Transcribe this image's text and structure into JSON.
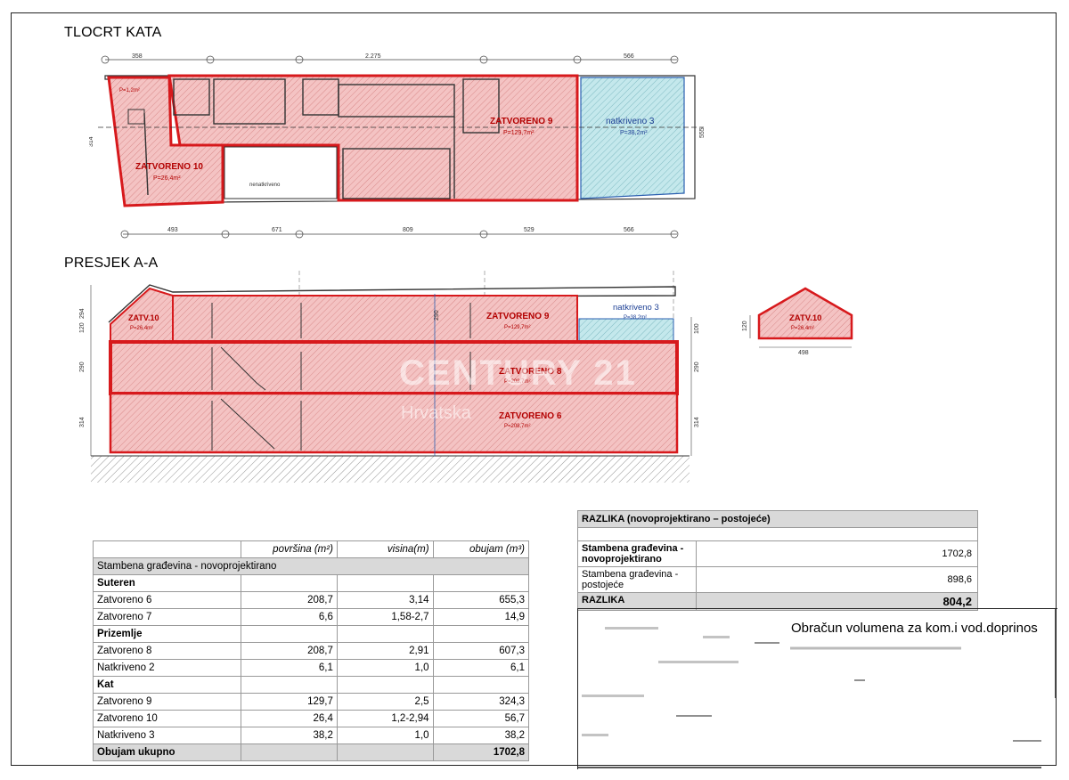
{
  "floor_plan": {
    "title": "TLOCRT KATA",
    "dims_top": [
      "358",
      "2.275",
      "566"
    ],
    "dims_bottom": [
      "493",
      "671",
      "809",
      "529",
      "566"
    ],
    "dim_left": "314",
    "dim_right": "555",
    "grid_labels_top": [
      "①",
      "②",
      "③",
      "④",
      "⑤",
      "⑥"
    ],
    "zones": {
      "zatvoreno10": {
        "label": "ZATVORENO 10",
        "area": "P=26,4m²"
      },
      "zatvoreno9": {
        "label": "ZATVORENO 9",
        "area": "P=129,7m²"
      },
      "natkriveno3": {
        "label": "natkriveno 3",
        "area": "P=38,2m²"
      },
      "nenatkriveno": "nenatkriveno",
      "small_area": "P=1,2m²"
    }
  },
  "section": {
    "title": "PRESJEK A-A",
    "zones": {
      "zatv10": {
        "label": "ZATV.10",
        "area": "P=26,4m²"
      },
      "zatvoreno9": {
        "label": "ZATVORENO 9",
        "area": "P=129,7m²"
      },
      "natkriveno3": {
        "label": "natkriveno 3",
        "area": "P=38,2m²"
      },
      "zatvoreno8": {
        "label": "ZATVORENO 8",
        "area": "P=208,7m²"
      },
      "zatvoreno6": {
        "label": "ZATVORENO 6",
        "area": "P=208,7m²"
      }
    },
    "dims_left": [
      "294",
      "120",
      "290",
      "314"
    ],
    "dims_right": [
      "100",
      "290",
      "314"
    ],
    "dim_middle": "290"
  },
  "roof_detail": {
    "label": "ZATV.10",
    "area": "P=26,4m²",
    "width": "498",
    "height": "120"
  },
  "watermark": {
    "brand": "CENTURY 21",
    "sub": "Hrvatska"
  },
  "volume_table": {
    "headers": [
      "",
      "površina (m²)",
      "visina(m)",
      "obujam (m³)"
    ],
    "building": "Stambena građevina - novoprojektirano",
    "groups": [
      {
        "name": "Suteren",
        "rows": [
          {
            "name": "Zatvoreno 6",
            "area": "208,7",
            "height": "3,14",
            "volume": "655,3"
          },
          {
            "name": "Zatvoreno 7",
            "area": "6,6",
            "height": "1,58-2,7",
            "volume": "14,9"
          }
        ]
      },
      {
        "name": "Prizemlje",
        "rows": [
          {
            "name": "Zatvoreno  8",
            "area": "208,7",
            "height": "2,91",
            "volume": "607,3"
          },
          {
            "name": "Natkriveno 2",
            "area": "6,1",
            "height": "1,0",
            "volume": "6,1"
          }
        ]
      },
      {
        "name": "Kat",
        "rows": [
          {
            "name": "Zatvoreno  9",
            "area": "129,7",
            "height": "2,5",
            "volume": "324,3"
          },
          {
            "name": "Zatvoreno  10",
            "area": "26,4",
            "height": "1,2-2,94",
            "volume": "56,7"
          },
          {
            "name": "Natkriveno 3",
            "area": "38,2",
            "height": "1,0",
            "volume": "38,2"
          }
        ]
      }
    ],
    "total_label": "Obujam ukupno",
    "total_value": "1702,8"
  },
  "razlika_table": {
    "title": "RAZLIKA (novoprojektirano – postojeće)",
    "rows": [
      {
        "label": "Stambena građevina - novoprojektirano",
        "value": "1702,8"
      },
      {
        "label": "Stambena građevina - postojeće",
        "value": "898,6"
      }
    ],
    "sum_label": "RAZLIKA",
    "sum_value": "804,2"
  },
  "obracun_title": "Obračun volumena za kom.i vod.doprinos",
  "colors": {
    "red": "#d7191c",
    "red_fill": "#f3bcbc",
    "blue_fill": "#bfe6ea",
    "grey": "#d9d9d9"
  }
}
